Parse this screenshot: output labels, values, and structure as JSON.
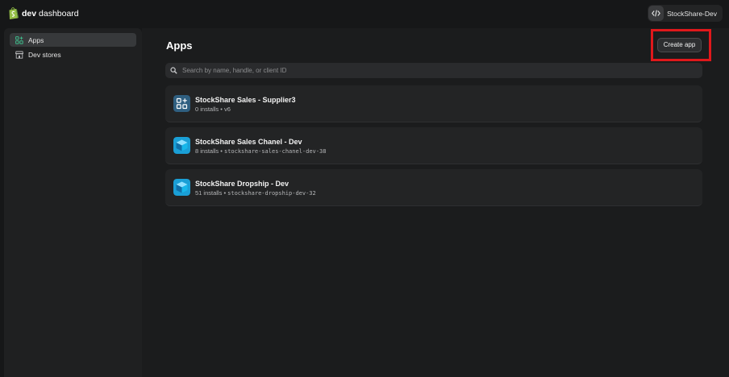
{
  "brand": {
    "bold": "dev",
    "rest": " dashboard"
  },
  "account": {
    "name": "StockShare-Dev",
    "icon": "code-icon"
  },
  "sidebar": {
    "items": [
      {
        "label": "Apps",
        "icon": "apps-grid-icon",
        "active": true
      },
      {
        "label": "Dev stores",
        "icon": "store-icon",
        "active": false
      }
    ]
  },
  "main": {
    "title": "Apps",
    "create_button_label": "Create app",
    "search": {
      "placeholder": "Search by name, handle, or client ID",
      "value": ""
    },
    "apps": [
      {
        "name": "StockShare Sales - Supplier3",
        "installs": "0 installs",
        "separator": " • ",
        "detail": "v6",
        "detail_mono": false,
        "icon": "grid-app-icon"
      },
      {
        "name": "StockShare Sales Chanel - Dev",
        "installs": "8 installs",
        "separator": " • ",
        "detail": "stockshare-sales-chanel-dev-38",
        "detail_mono": true,
        "icon": "stockshare-logo-icon"
      },
      {
        "name": "StockShare Dropship - Dev",
        "installs": "51 installs",
        "separator": " • ",
        "detail": "stockshare-dropship-dev-32",
        "detail_mono": true,
        "icon": "stockshare-logo-icon"
      }
    ]
  },
  "colors": {
    "highlight": "#e0181b",
    "accent": "#1a9fd6",
    "background": "#161718"
  }
}
